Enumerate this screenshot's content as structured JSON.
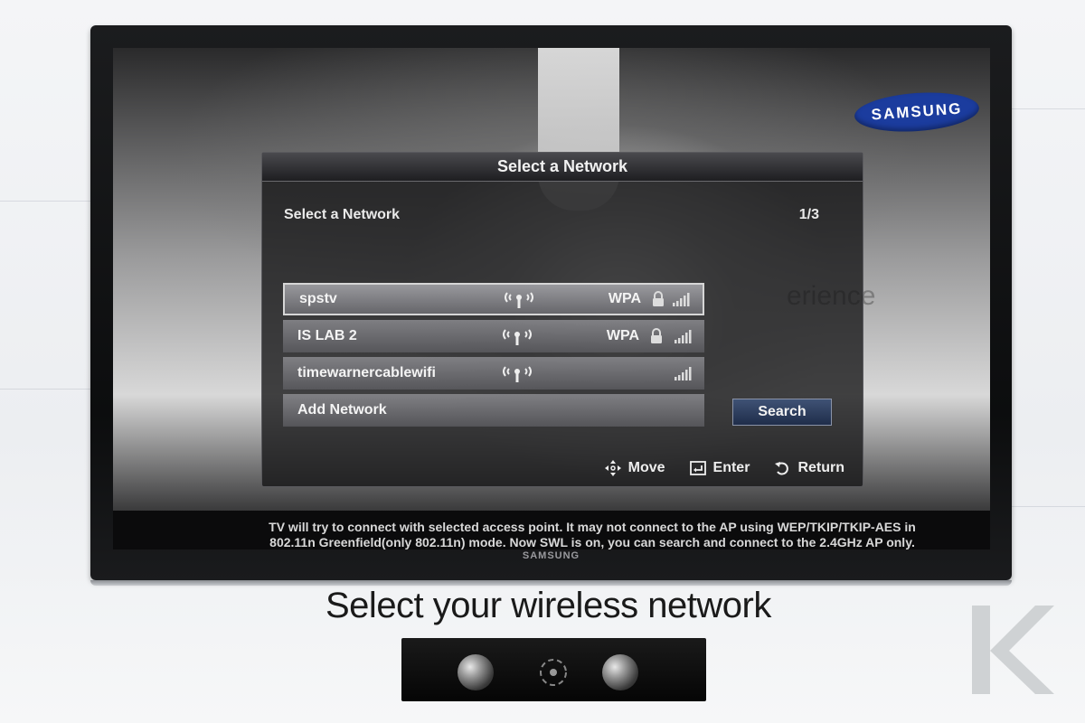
{
  "tv": {
    "brand_logo": "SAMSUNG",
    "bezel_brand": "SAMSUNG",
    "wallpaper_text_right": "erience",
    "wallpaper_text": ""
  },
  "dialog": {
    "title": "Select a Network",
    "subtitle": "Select a Network",
    "page_indicator": "1/3",
    "networks": [
      {
        "name": "spstv",
        "security": "WPA",
        "locked": true,
        "selected": true
      },
      {
        "name": "IS LAB 2",
        "security": "WPA",
        "locked": true,
        "selected": false
      },
      {
        "name": "timewarnercablewifi",
        "security": "",
        "locked": false,
        "selected": false
      },
      {
        "name": "Add Network"
      }
    ],
    "search_label": "Search",
    "footer": {
      "move_label": "Move",
      "enter_label": "Enter",
      "return_label": "Return"
    }
  },
  "info": {
    "line1": "TV will try to connect with selected access point. It may not connect to the AP using WEP/TKIP/TKIP-AES in",
    "line2": "802.11n Greenfield(only 802.11n) mode. Now SWL is on, you can search and connect to the 2.4GHz AP only."
  },
  "caption": "Select your wireless network",
  "icons": {
    "move": "dpad-icon",
    "enter": "enter-icon",
    "return": "return-icon",
    "access_point": "access-point-icon",
    "lock": "lock-icon",
    "signal": "signal-strength-icon"
  },
  "colors": {
    "samsung_blue": "#1b3c9e",
    "search_button": "#2a3a5e"
  }
}
